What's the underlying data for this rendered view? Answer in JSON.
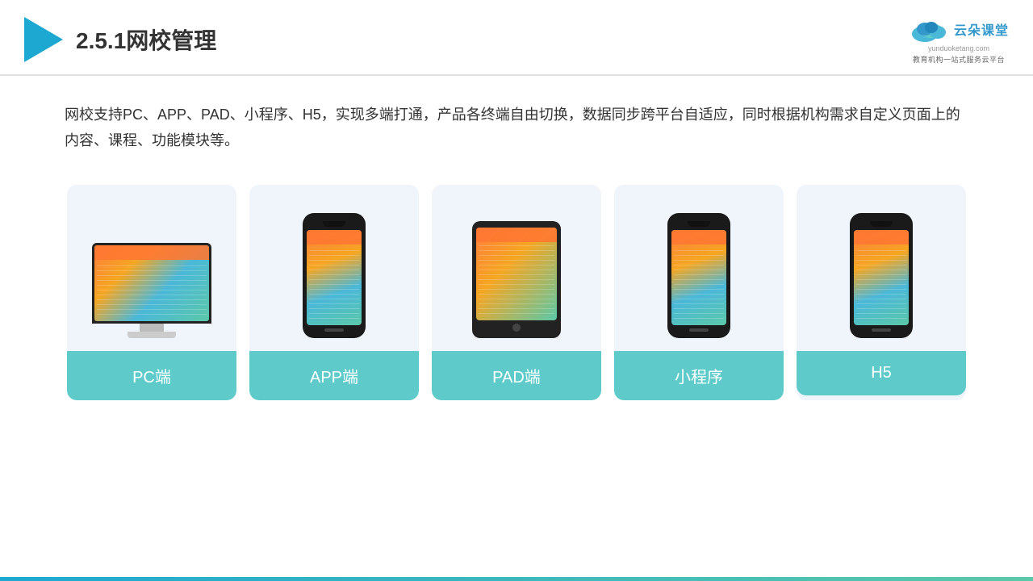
{
  "header": {
    "section_number": "2.5.1",
    "title": "网校管理",
    "brand": {
      "name": "云朵课堂",
      "url": "yunduoketang.com",
      "tagline": "教育机构一站式服务云平台"
    }
  },
  "description": {
    "text": "网校支持PC、APP、PAD、小程序、H5，实现多端打通，产品各终端自由切换，数据同步跨平台自适应，同时根据机构需求自定义页面上的内容、课程、功能模块等。"
  },
  "devices": [
    {
      "id": "pc",
      "label": "PC端",
      "type": "monitor"
    },
    {
      "id": "app",
      "label": "APP端",
      "type": "phone-app"
    },
    {
      "id": "pad",
      "label": "PAD端",
      "type": "tablet"
    },
    {
      "id": "mini",
      "label": "小程序",
      "type": "phone"
    },
    {
      "id": "h5",
      "label": "H5",
      "type": "phone"
    }
  ],
  "colors": {
    "teal": "#5ecbca",
    "blue": "#1da8d1",
    "accent": "#ff7c3a"
  }
}
